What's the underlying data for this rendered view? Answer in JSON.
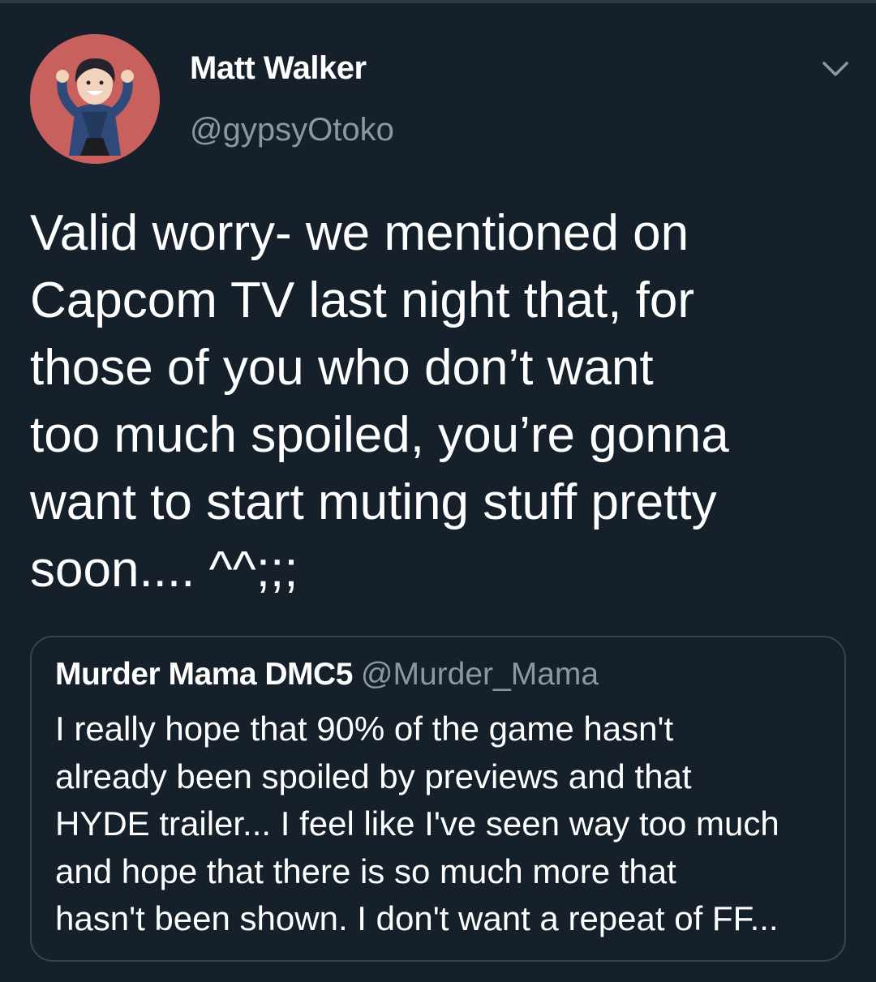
{
  "tweet": {
    "author": {
      "name": "Matt Walker",
      "handle": "@gypsyOtoko"
    },
    "text": "Valid worry- we mentioned on\nCapcom TV last night that, for\nthose of you who don’t want\ntoo much spoiled, you’re gonna\nwant to start muting stuff pretty\nsoon.... ^^;;;",
    "quoted": {
      "name": "Murder Mama DMC5",
      "handle": "@Murder_Mama",
      "text": "I really hope that 90% of the game hasn't\nalready been spoiled by previews and that\nHYDE trailer... I feel like I've seen way too much\nand hope that there is so much more that\nhasn't been shown. I don't want a repeat of FF..."
    }
  },
  "colors": {
    "background": "#15202b",
    "text_primary": "#ffffff",
    "text_secondary": "#8899a6",
    "border": "#38444d",
    "avatar_bg": "#c8605e"
  },
  "icons": {
    "more": "chevron-down-icon"
  }
}
